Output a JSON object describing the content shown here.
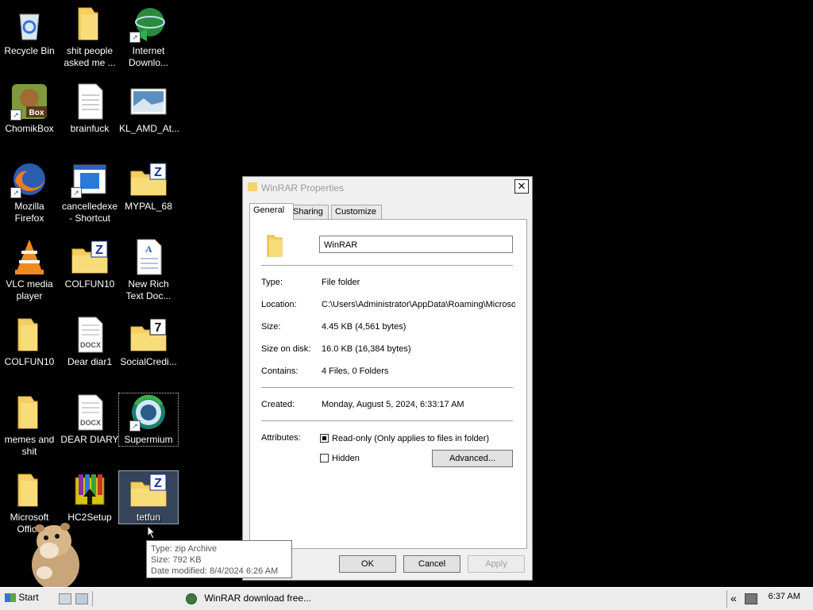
{
  "desktop": {
    "icons": [
      {
        "name": "Recycle Bin",
        "type": "recycle"
      },
      {
        "name": "shit people asked me ...",
        "type": "folder"
      },
      {
        "name": "Internet Downlo...",
        "type": "idm"
      },
      {
        "name": "ChomikBox",
        "type": "chomik"
      },
      {
        "name": "brainfuck",
        "type": "text"
      },
      {
        "name": "KL_AMD_At...",
        "type": "image"
      },
      {
        "name": "Mozilla Firefox",
        "type": "firefox"
      },
      {
        "name": "cancelledexe - Shortcut",
        "type": "exe"
      },
      {
        "name": "MYPAL_68",
        "type": "zipfolder"
      },
      {
        "name": "VLC media player",
        "type": "vlc"
      },
      {
        "name": "COLFUN10",
        "type": "zipfolder"
      },
      {
        "name": "New Rich Text Doc...",
        "type": "rtf"
      },
      {
        "name": "COLFUN10",
        "type": "folder"
      },
      {
        "name": "Dear diar1",
        "type": "docx"
      },
      {
        "name": "SocialCredi...",
        "type": "7zfolder"
      },
      {
        "name": "memes and shit",
        "type": "folder"
      },
      {
        "name": "DEAR DIARY",
        "type": "docx"
      },
      {
        "name": "Supermium",
        "type": "supermium"
      },
      {
        "name": "Microsoft Office",
        "type": "folder"
      },
      {
        "name": "HC2Setup",
        "type": "winrar"
      },
      {
        "name": "tetfun",
        "type": "zipfolder"
      }
    ]
  },
  "dialog": {
    "title": "WinRAR Properties",
    "close_label": "✕",
    "tabs": [
      "General",
      "Sharing",
      "Customize"
    ],
    "name_value": "WinRAR",
    "props": {
      "type_label": "Type:",
      "type_value": "File folder",
      "location_label": "Location:",
      "location_value": "C:\\Users\\Administrator\\AppData\\Roaming\\Microsof",
      "size_label": "Size:",
      "size_value": "4.45 KB (4,561 bytes)",
      "size_disk_label": "Size on disk:",
      "size_disk_value": "16.0 KB (16,384 bytes)",
      "contains_label": "Contains:",
      "contains_value": "4 Files, 0 Folders",
      "created_label": "Created:",
      "created_value": "Monday, August 5, 2024, 6:33:17 AM",
      "attributes_label": "Attributes:"
    },
    "readonly_label": "Read-only (Only applies to files in folder)",
    "hidden_label": "Hidden",
    "advanced_label": "Advanced...",
    "ok_label": "OK",
    "cancel_label": "Cancel",
    "apply_label": "Apply"
  },
  "tooltip": {
    "line1": "Type: zip Archive",
    "line2": "Size: 792 KB",
    "line3": "Date modified: 8/4/2024 6:26 AM"
  },
  "taskbar": {
    "start_label": "Start",
    "item_label": "WinRAR download free...",
    "tray_chevron": "«",
    "clock": "6:37 AM"
  }
}
